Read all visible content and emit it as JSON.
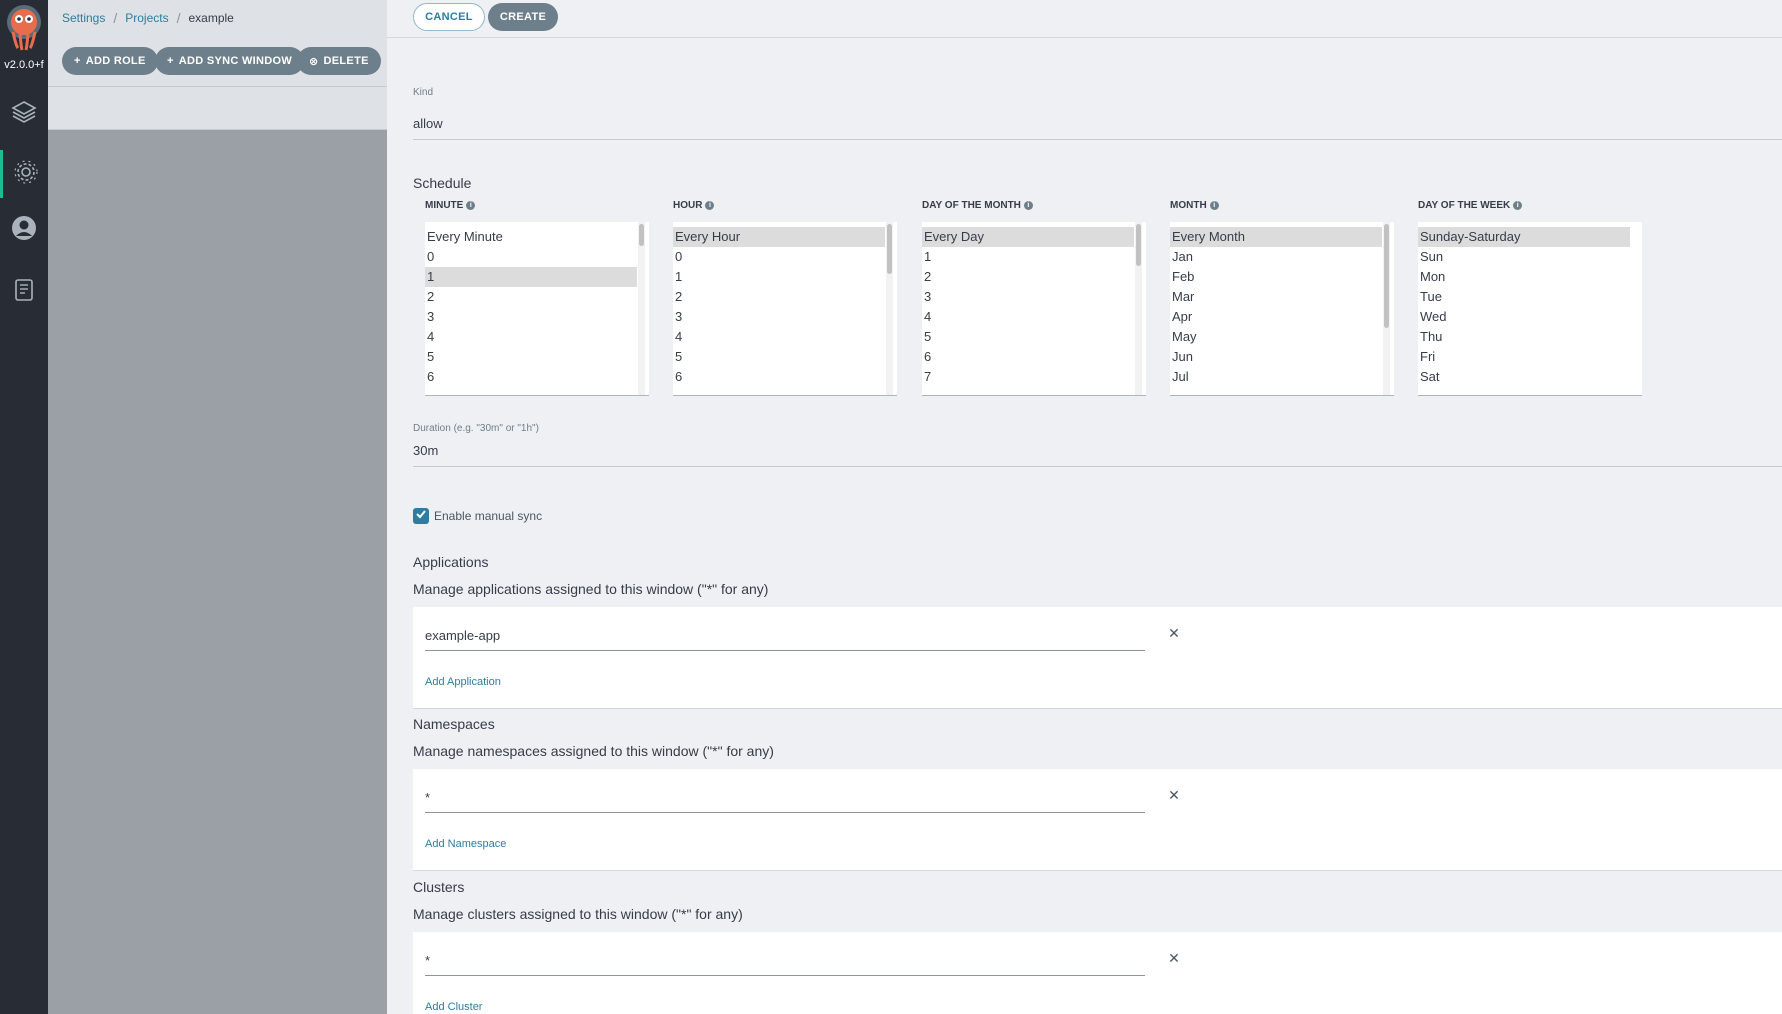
{
  "nav": {
    "version": "v2.0.0+f",
    "items": [
      "applications-icon",
      "settings-icon",
      "user-icon",
      "docs-icon"
    ]
  },
  "breadcrumb": {
    "items": [
      "Settings",
      "Projects"
    ],
    "current": "example"
  },
  "toolbar": {
    "add_role": "ADD ROLE",
    "add_sync_window": "ADD SYNC WINDOW",
    "delete": "DELETE"
  },
  "panel": {
    "cancel_label": "CANCEL",
    "create_label": "CREATE",
    "kind": {
      "label": "Kind",
      "value": "allow"
    },
    "schedule": {
      "title": "Schedule",
      "columns": [
        {
          "label": "MINUTE",
          "selected": "1",
          "options": [
            "Every Minute",
            "0",
            "1",
            "2",
            "3",
            "4",
            "5",
            "6"
          ]
        },
        {
          "label": "HOUR",
          "selected": "Every Hour",
          "options": [
            "Every Hour",
            "0",
            "1",
            "2",
            "3",
            "4",
            "5",
            "6"
          ]
        },
        {
          "label": "DAY OF THE MONTH",
          "selected": "Every Day",
          "options": [
            "Every Day",
            "1",
            "2",
            "3",
            "4",
            "5",
            "6",
            "7"
          ]
        },
        {
          "label": "MONTH",
          "selected": "Every Month",
          "options": [
            "Every Month",
            "Jan",
            "Feb",
            "Mar",
            "Apr",
            "May",
            "Jun",
            "Jul"
          ]
        },
        {
          "label": "DAY OF THE WEEK",
          "selected": "Sunday-Saturday",
          "options": [
            "Sunday-Saturday",
            "Sun",
            "Mon",
            "Tue",
            "Wed",
            "Thu",
            "Fri",
            "Sat"
          ]
        }
      ]
    },
    "duration": {
      "label": "Duration (e.g. \"30m\" or \"1h\")",
      "value": "30m"
    },
    "manual_sync": {
      "label": "Enable manual sync",
      "checked": true
    },
    "applications": {
      "title": "Applications",
      "desc": "Manage applications assigned to this window (\"*\" for any)",
      "value": "example-app",
      "add_label": "Add Application"
    },
    "namespaces": {
      "title": "Namespaces",
      "desc": "Manage namespaces assigned to this window (\"*\" for any)",
      "value": "*",
      "add_label": "Add Namespace"
    },
    "clusters": {
      "title": "Clusters",
      "desc": "Manage clusters assigned to this window (\"*\" for any)",
      "value": "*",
      "add_label": "Add Cluster"
    }
  },
  "colors": {
    "accent": "#2c7da0",
    "nav_bg": "#282c34",
    "active_indicator": "#18be94",
    "button_bg": "#6d7f8b"
  }
}
